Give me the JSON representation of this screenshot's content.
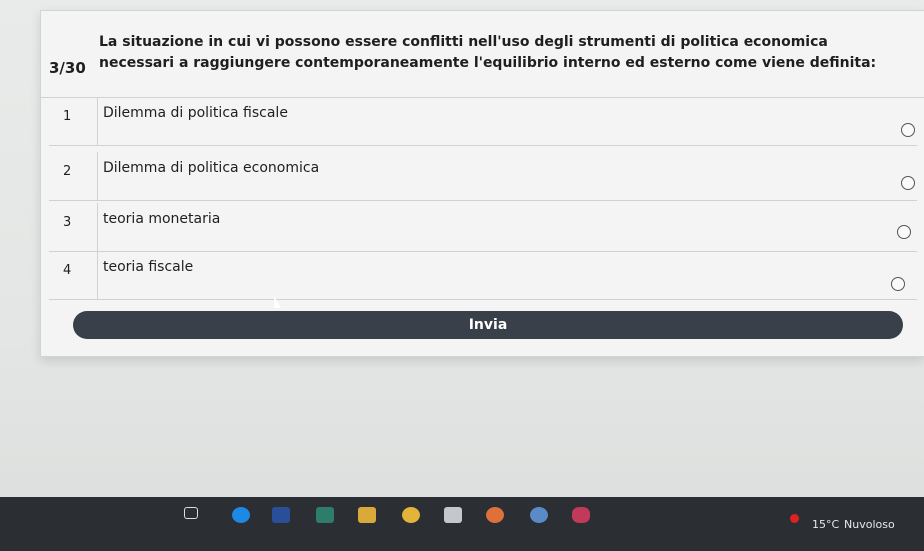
{
  "question": {
    "counter": "3/30",
    "text": "La situazione in cui vi possono essere conflitti nell'uso degli strumenti di politica economica necessari a raggiungere contemporaneamente l'equilibrio interno ed esterno come viene definita:"
  },
  "options": [
    {
      "number": "1",
      "label": "Dilemma di politica fiscale"
    },
    {
      "number": "2",
      "label": "Dilemma di politica economica"
    },
    {
      "number": "3",
      "label": "teoria monetaria"
    },
    {
      "number": "4",
      "label": "teoria fiscale"
    }
  ],
  "submit_label": "Invia",
  "taskbar": {
    "temperature": "15°C",
    "weather": "Nuvoloso",
    "icons": [
      "task-view-icon",
      "edge-icon",
      "store-icon",
      "photos-icon",
      "file-explorer-icon",
      "chrome-icon",
      "word-icon",
      "firefox-icon",
      "app-icon",
      "game-icon"
    ]
  }
}
